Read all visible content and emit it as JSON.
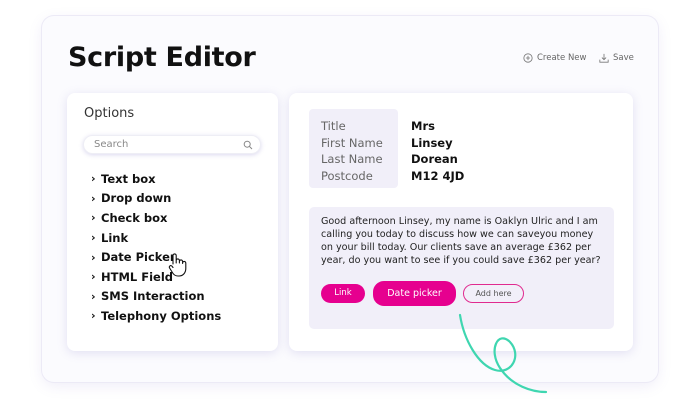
{
  "page": {
    "title": "Script Editor",
    "create_new": "Create New",
    "save": "Save"
  },
  "options": {
    "heading": "Options",
    "search_placeholder": "Search",
    "items": [
      {
        "label": "Text box"
      },
      {
        "label": "Drop down"
      },
      {
        "label": "Check box"
      },
      {
        "label": "Link"
      },
      {
        "label": "Date Picker",
        "highlighted": true
      },
      {
        "label": "HTML Field"
      },
      {
        "label": "SMS Interaction"
      },
      {
        "label": "Telephony Options"
      }
    ]
  },
  "customer": {
    "fields": [
      {
        "label": "Title",
        "value": "Mrs"
      },
      {
        "label": "First Name",
        "value": "Linsey"
      },
      {
        "label": "Last Name",
        "value": "Dorean"
      },
      {
        "label": "Postcode",
        "value": "M12 4JD"
      }
    ]
  },
  "script": {
    "text": "Good afternoon Linsey, my name is Oaklyn Ulric and I am calling you today to discuss how we can saveyou money on your bill today. Our clients save an average £362 per year, do you want to see if you could save £362 per year?",
    "buttons": {
      "link": "Link",
      "date_picker": "Date picker",
      "add_here": "Add here"
    }
  },
  "colors": {
    "accent": "#e6008f",
    "panel_tint": "#f1eff9",
    "swirl": "#3fd6b0"
  },
  "icons": [
    "plus-circle-icon",
    "download-icon",
    "search-icon",
    "chevron-right-icon",
    "hand-cursor-icon"
  ]
}
